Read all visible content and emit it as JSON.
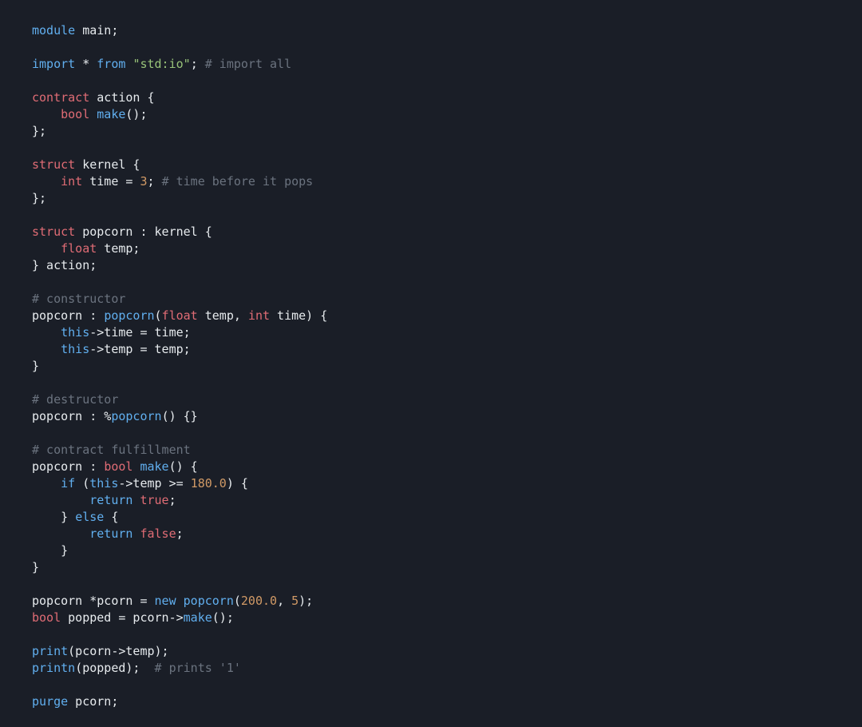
{
  "code": {
    "tokens": [
      [
        [
          "kw",
          "module"
        ],
        [
          null,
          " main;"
        ]
      ],
      [],
      [
        [
          "kw",
          "import"
        ],
        [
          null,
          " * "
        ],
        [
          "kw",
          "from"
        ],
        [
          null,
          " "
        ],
        [
          "str",
          "\"std:io\""
        ],
        [
          null,
          "; "
        ],
        [
          "cmt",
          "# import all"
        ]
      ],
      [],
      [
        [
          "dkw",
          "contract"
        ],
        [
          null,
          " action {"
        ]
      ],
      [
        [
          null,
          "    "
        ],
        [
          "dkw",
          "bool"
        ],
        [
          null,
          " "
        ],
        [
          "fn",
          "make"
        ],
        [
          null,
          "();"
        ]
      ],
      [
        [
          null,
          "};"
        ]
      ],
      [],
      [
        [
          "dkw",
          "struct"
        ],
        [
          null,
          " kernel {"
        ]
      ],
      [
        [
          null,
          "    "
        ],
        [
          "dkw",
          "int"
        ],
        [
          null,
          " time = "
        ],
        [
          "num",
          "3"
        ],
        [
          null,
          "; "
        ],
        [
          "cmt",
          "# time before it pops"
        ]
      ],
      [
        [
          null,
          "};"
        ]
      ],
      [],
      [
        [
          "dkw",
          "struct"
        ],
        [
          null,
          " popcorn : kernel {"
        ]
      ],
      [
        [
          null,
          "    "
        ],
        [
          "dkw",
          "float"
        ],
        [
          null,
          " temp;"
        ]
      ],
      [
        [
          null,
          "} action;"
        ]
      ],
      [],
      [
        [
          "cmt",
          "# constructor"
        ]
      ],
      [
        [
          null,
          "popcorn : "
        ],
        [
          "fn",
          "popcorn"
        ],
        [
          null,
          "("
        ],
        [
          "dkw",
          "float"
        ],
        [
          null,
          " temp, "
        ],
        [
          "dkw",
          "int"
        ],
        [
          null,
          " time) {"
        ]
      ],
      [
        [
          null,
          "    "
        ],
        [
          "kw",
          "this"
        ],
        [
          null,
          "->time = time;"
        ]
      ],
      [
        [
          null,
          "    "
        ],
        [
          "kw",
          "this"
        ],
        [
          null,
          "->temp = temp;"
        ]
      ],
      [
        [
          null,
          "}"
        ]
      ],
      [],
      [
        [
          "cmt",
          "# destructor"
        ]
      ],
      [
        [
          null,
          "popcorn : %"
        ],
        [
          "fn",
          "popcorn"
        ],
        [
          null,
          "() {}"
        ]
      ],
      [],
      [
        [
          "cmt",
          "# contract fulfillment"
        ]
      ],
      [
        [
          null,
          "popcorn : "
        ],
        [
          "dkw",
          "bool"
        ],
        [
          null,
          " "
        ],
        [
          "fn",
          "make"
        ],
        [
          null,
          "() {"
        ]
      ],
      [
        [
          null,
          "    "
        ],
        [
          "kw",
          "if"
        ],
        [
          null,
          " ("
        ],
        [
          "kw",
          "this"
        ],
        [
          null,
          "->temp >= "
        ],
        [
          "num",
          "180.0"
        ],
        [
          null,
          ") {"
        ]
      ],
      [
        [
          null,
          "        "
        ],
        [
          "kw",
          "return"
        ],
        [
          null,
          " "
        ],
        [
          "bool",
          "true"
        ],
        [
          null,
          ";"
        ]
      ],
      [
        [
          null,
          "    } "
        ],
        [
          "kw",
          "else"
        ],
        [
          null,
          " {"
        ]
      ],
      [
        [
          null,
          "        "
        ],
        [
          "kw",
          "return"
        ],
        [
          null,
          " "
        ],
        [
          "bool",
          "false"
        ],
        [
          null,
          ";"
        ]
      ],
      [
        [
          null,
          "    }"
        ]
      ],
      [
        [
          null,
          "}"
        ]
      ],
      [],
      [
        [
          null,
          "popcorn *pcorn = "
        ],
        [
          "kw",
          "new"
        ],
        [
          null,
          " "
        ],
        [
          "fn",
          "popcorn"
        ],
        [
          null,
          "("
        ],
        [
          "num",
          "200.0"
        ],
        [
          null,
          ", "
        ],
        [
          "num",
          "5"
        ],
        [
          null,
          ");"
        ]
      ],
      [
        [
          "dkw",
          "bool"
        ],
        [
          null,
          " popped = pcorn->"
        ],
        [
          "fn",
          "make"
        ],
        [
          null,
          "();"
        ]
      ],
      [],
      [
        [
          "fn",
          "print"
        ],
        [
          null,
          "(pcorn->temp);"
        ]
      ],
      [
        [
          "fn",
          "printn"
        ],
        [
          null,
          "(popped);  "
        ],
        [
          "cmt",
          "# prints '1'"
        ]
      ],
      [],
      [
        [
          "kw",
          "purge"
        ],
        [
          null,
          " pcorn;"
        ]
      ]
    ]
  }
}
